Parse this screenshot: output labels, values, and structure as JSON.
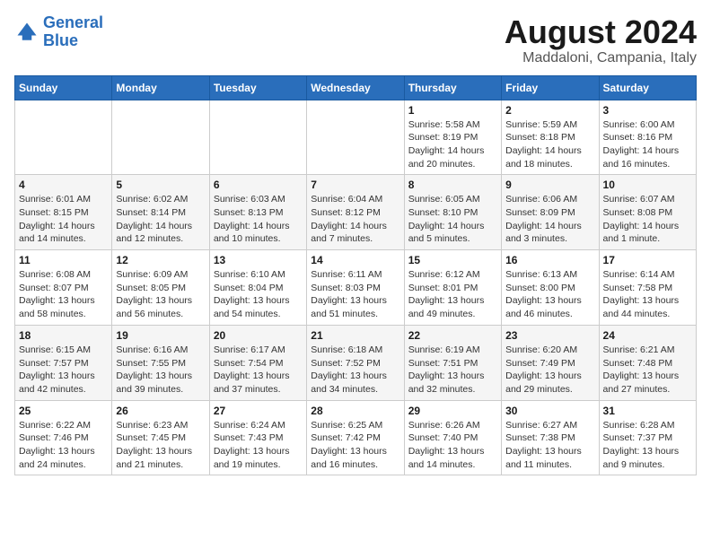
{
  "logo": {
    "line1": "General",
    "line2": "Blue"
  },
  "title": "August 2024",
  "subtitle": "Maddaloni, Campania, Italy",
  "days_of_week": [
    "Sunday",
    "Monday",
    "Tuesday",
    "Wednesday",
    "Thursday",
    "Friday",
    "Saturday"
  ],
  "weeks": [
    [
      {
        "day": "",
        "info": ""
      },
      {
        "day": "",
        "info": ""
      },
      {
        "day": "",
        "info": ""
      },
      {
        "day": "",
        "info": ""
      },
      {
        "day": "1",
        "info": "Sunrise: 5:58 AM\nSunset: 8:19 PM\nDaylight: 14 hours and 20 minutes."
      },
      {
        "day": "2",
        "info": "Sunrise: 5:59 AM\nSunset: 8:18 PM\nDaylight: 14 hours and 18 minutes."
      },
      {
        "day": "3",
        "info": "Sunrise: 6:00 AM\nSunset: 8:16 PM\nDaylight: 14 hours and 16 minutes."
      }
    ],
    [
      {
        "day": "4",
        "info": "Sunrise: 6:01 AM\nSunset: 8:15 PM\nDaylight: 14 hours and 14 minutes."
      },
      {
        "day": "5",
        "info": "Sunrise: 6:02 AM\nSunset: 8:14 PM\nDaylight: 14 hours and 12 minutes."
      },
      {
        "day": "6",
        "info": "Sunrise: 6:03 AM\nSunset: 8:13 PM\nDaylight: 14 hours and 10 minutes."
      },
      {
        "day": "7",
        "info": "Sunrise: 6:04 AM\nSunset: 8:12 PM\nDaylight: 14 hours and 7 minutes."
      },
      {
        "day": "8",
        "info": "Sunrise: 6:05 AM\nSunset: 8:10 PM\nDaylight: 14 hours and 5 minutes."
      },
      {
        "day": "9",
        "info": "Sunrise: 6:06 AM\nSunset: 8:09 PM\nDaylight: 14 hours and 3 minutes."
      },
      {
        "day": "10",
        "info": "Sunrise: 6:07 AM\nSunset: 8:08 PM\nDaylight: 14 hours and 1 minute."
      }
    ],
    [
      {
        "day": "11",
        "info": "Sunrise: 6:08 AM\nSunset: 8:07 PM\nDaylight: 13 hours and 58 minutes."
      },
      {
        "day": "12",
        "info": "Sunrise: 6:09 AM\nSunset: 8:05 PM\nDaylight: 13 hours and 56 minutes."
      },
      {
        "day": "13",
        "info": "Sunrise: 6:10 AM\nSunset: 8:04 PM\nDaylight: 13 hours and 54 minutes."
      },
      {
        "day": "14",
        "info": "Sunrise: 6:11 AM\nSunset: 8:03 PM\nDaylight: 13 hours and 51 minutes."
      },
      {
        "day": "15",
        "info": "Sunrise: 6:12 AM\nSunset: 8:01 PM\nDaylight: 13 hours and 49 minutes."
      },
      {
        "day": "16",
        "info": "Sunrise: 6:13 AM\nSunset: 8:00 PM\nDaylight: 13 hours and 46 minutes."
      },
      {
        "day": "17",
        "info": "Sunrise: 6:14 AM\nSunset: 7:58 PM\nDaylight: 13 hours and 44 minutes."
      }
    ],
    [
      {
        "day": "18",
        "info": "Sunrise: 6:15 AM\nSunset: 7:57 PM\nDaylight: 13 hours and 42 minutes."
      },
      {
        "day": "19",
        "info": "Sunrise: 6:16 AM\nSunset: 7:55 PM\nDaylight: 13 hours and 39 minutes."
      },
      {
        "day": "20",
        "info": "Sunrise: 6:17 AM\nSunset: 7:54 PM\nDaylight: 13 hours and 37 minutes."
      },
      {
        "day": "21",
        "info": "Sunrise: 6:18 AM\nSunset: 7:52 PM\nDaylight: 13 hours and 34 minutes."
      },
      {
        "day": "22",
        "info": "Sunrise: 6:19 AM\nSunset: 7:51 PM\nDaylight: 13 hours and 32 minutes."
      },
      {
        "day": "23",
        "info": "Sunrise: 6:20 AM\nSunset: 7:49 PM\nDaylight: 13 hours and 29 minutes."
      },
      {
        "day": "24",
        "info": "Sunrise: 6:21 AM\nSunset: 7:48 PM\nDaylight: 13 hours and 27 minutes."
      }
    ],
    [
      {
        "day": "25",
        "info": "Sunrise: 6:22 AM\nSunset: 7:46 PM\nDaylight: 13 hours and 24 minutes."
      },
      {
        "day": "26",
        "info": "Sunrise: 6:23 AM\nSunset: 7:45 PM\nDaylight: 13 hours and 21 minutes."
      },
      {
        "day": "27",
        "info": "Sunrise: 6:24 AM\nSunset: 7:43 PM\nDaylight: 13 hours and 19 minutes."
      },
      {
        "day": "28",
        "info": "Sunrise: 6:25 AM\nSunset: 7:42 PM\nDaylight: 13 hours and 16 minutes."
      },
      {
        "day": "29",
        "info": "Sunrise: 6:26 AM\nSunset: 7:40 PM\nDaylight: 13 hours and 14 minutes."
      },
      {
        "day": "30",
        "info": "Sunrise: 6:27 AM\nSunset: 7:38 PM\nDaylight: 13 hours and 11 minutes."
      },
      {
        "day": "31",
        "info": "Sunrise: 6:28 AM\nSunset: 7:37 PM\nDaylight: 13 hours and 9 minutes."
      }
    ]
  ]
}
